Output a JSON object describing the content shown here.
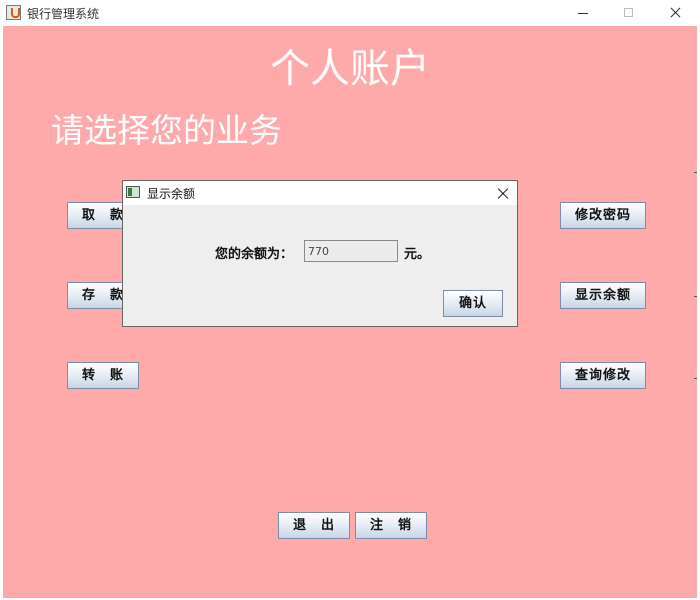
{
  "window": {
    "title": "银行管理系统",
    "icon": "java-cup-icon"
  },
  "main": {
    "heading": "个人账户",
    "subheading": "请选择您的业务",
    "left_buttons": [
      "取　款",
      "存　款",
      "转　账"
    ],
    "right_buttons": [
      "修改密码",
      "显示余额",
      "查询修改"
    ],
    "bottom_buttons": [
      "退　出",
      "注　销"
    ]
  },
  "dialog": {
    "title": "显示余额",
    "label": "您的余额为：",
    "balance": "770",
    "unit": "元。",
    "ok_label": "确认"
  },
  "colors": {
    "background": "#ffaaaa",
    "text": "#ffffff"
  }
}
